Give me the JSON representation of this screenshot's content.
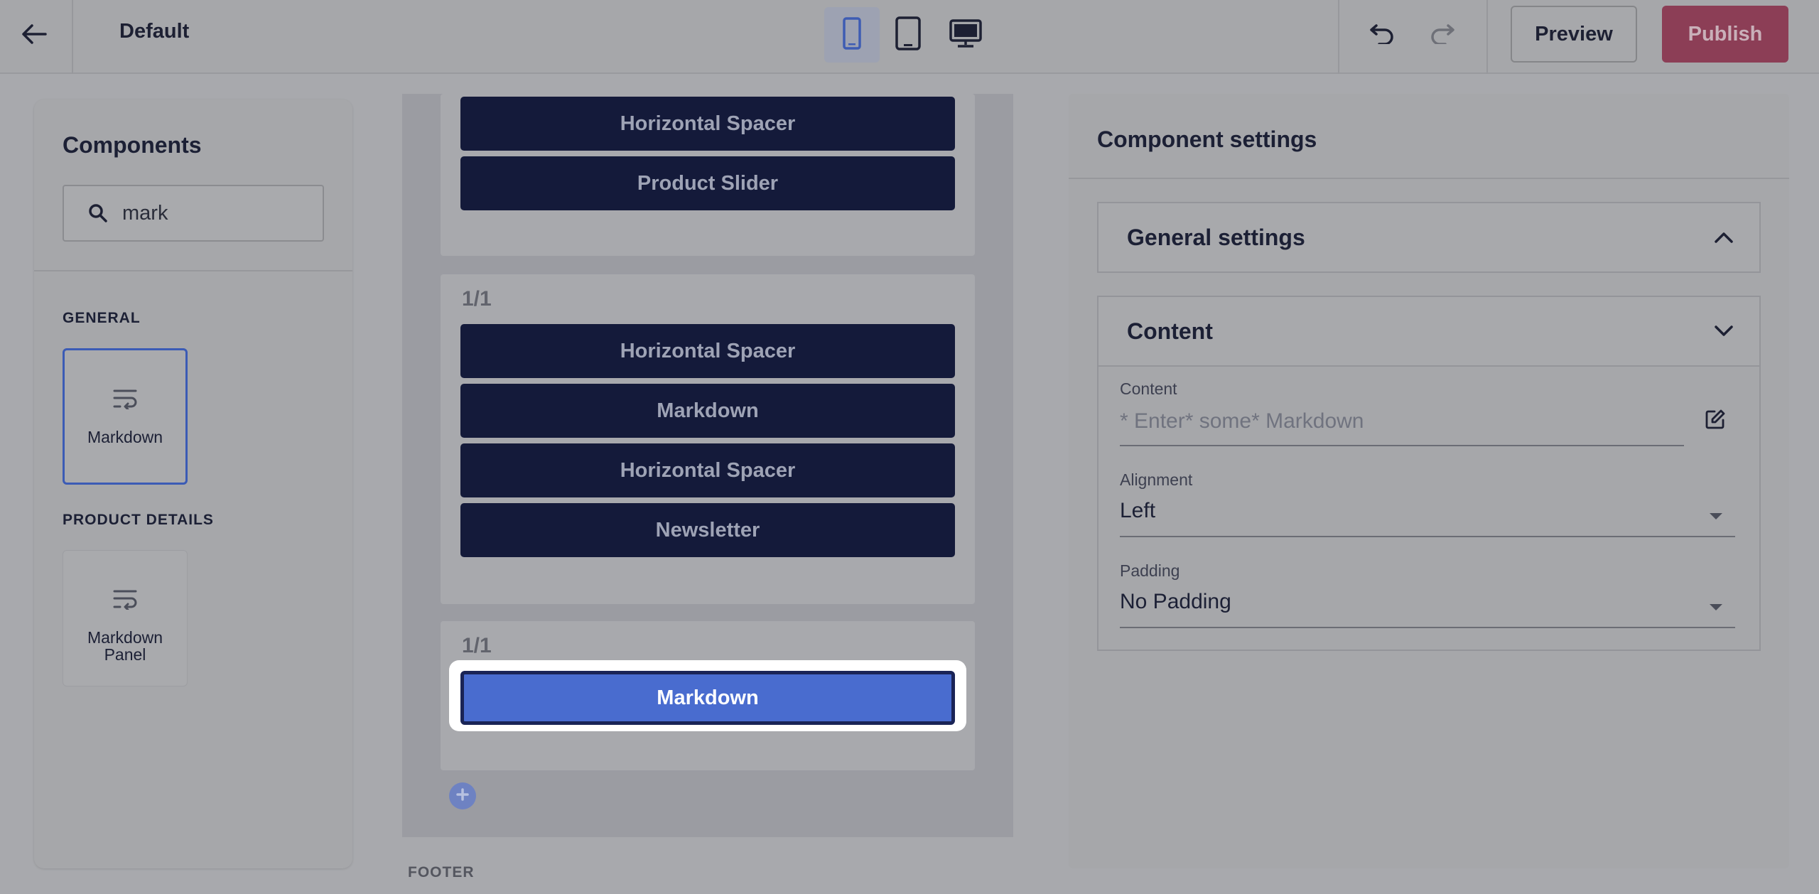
{
  "topbar": {
    "page_name": "Default",
    "devices": [
      "mobile-icon",
      "tablet-icon",
      "desktop-icon"
    ],
    "active_device": "mobile",
    "preview_label": "Preview",
    "publish_label": "Publish"
  },
  "components_panel": {
    "title": "Components",
    "search": {
      "value": "mark",
      "placeholder": ""
    },
    "sections": [
      {
        "label": "GENERAL",
        "items": [
          {
            "label": "Markdown",
            "icon": "wrap-text-icon",
            "selected": true
          }
        ]
      },
      {
        "label": "PRODUCT DETAILS",
        "items": [
          {
            "label": "Markdown Panel",
            "icon": "wrap-text-icon",
            "selected": false
          }
        ]
      }
    ]
  },
  "canvas": {
    "rows": [
      {
        "label": "",
        "blocks": [
          "Horizontal Spacer",
          "Product Slider"
        ]
      },
      {
        "label": "1/1",
        "blocks": [
          "Horizontal Spacer",
          "Markdown",
          "Horizontal Spacer",
          "Newsletter"
        ]
      },
      {
        "label": "1/1",
        "blocks": [
          "Markdown"
        ],
        "selected_block": "Markdown"
      }
    ],
    "footer_label": "FOOTER"
  },
  "settings_panel": {
    "title": "Component settings",
    "general_settings_label": "General settings",
    "content_section_label": "Content",
    "fields": {
      "content": {
        "label": "Content",
        "placeholder": "* Enter* some* Markdown",
        "value": ""
      },
      "alignment": {
        "label": "Alignment",
        "value": "Left"
      },
      "padding": {
        "label": "Padding",
        "value": "No Padding"
      }
    }
  },
  "colors": {
    "brand_navy": "#141a3a",
    "selected_blue": "#496ccf",
    "publish": "#8c3e56"
  }
}
